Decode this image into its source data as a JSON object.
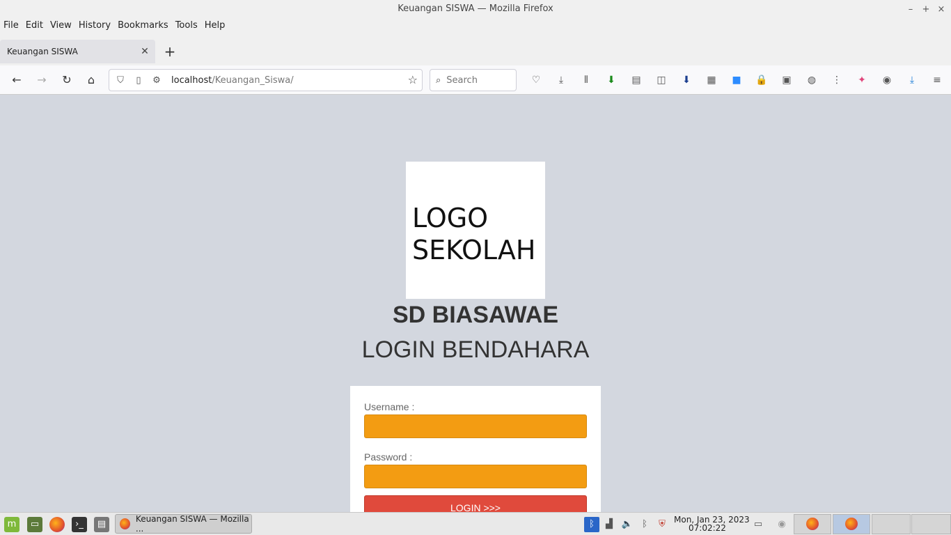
{
  "window": {
    "title": "Keuangan SISWA — Mozilla Firefox"
  },
  "menubar": [
    "File",
    "Edit",
    "View",
    "History",
    "Bookmarks",
    "Tools",
    "Help"
  ],
  "tab": {
    "title": "Keuangan SISWA"
  },
  "navbar": {
    "url_host": "localhost",
    "url_path": "/Keuangan_Siswa/",
    "search_placeholder": "Search"
  },
  "page": {
    "logo_line1": "LOGO",
    "logo_line2": "SEKOLAH",
    "school_name": "SD BIASAWAE",
    "heading": "LOGIN BENDAHARA",
    "username_label": "Username :",
    "password_label": "Password :",
    "username_value": "",
    "password_value": "",
    "login_button": "LOGIN >>>"
  },
  "taskbar": {
    "window_label": "Keuangan SISWA — Mozilla ...",
    "clock_date": "Mon, Jan 23, 2023",
    "clock_time": "07:02:22"
  },
  "colors": {
    "input_bg": "#f39c12",
    "login_button_bg": "#e04a3c",
    "page_bg": "#d3d7df"
  }
}
